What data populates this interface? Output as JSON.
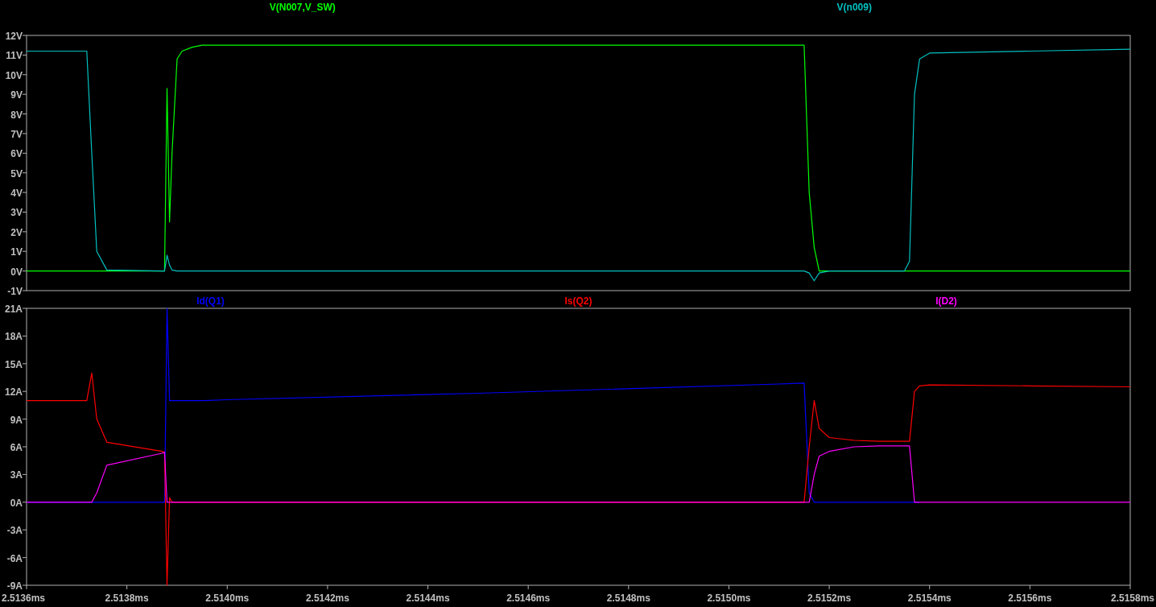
{
  "panes": [
    {
      "chart_data": {
        "type": "line",
        "x": [
          2.5136,
          2.51372,
          2.51373,
          2.51374,
          2.51376,
          2.51387,
          2.513875,
          2.51388,
          2.513885,
          2.51389,
          2.5139,
          2.51391,
          2.51393,
          2.51395,
          2.514,
          2.5145,
          2.5151,
          2.51515,
          2.51516,
          2.51517,
          2.51518,
          2.5152,
          2.51525,
          2.5153,
          2.51535,
          2.51536,
          2.51537,
          2.51538,
          2.5154,
          2.5156,
          2.5158
        ],
        "series": [
          {
            "name": "V(N007,V_SW)",
            "color": "#00ff00",
            "values": [
              0,
              0,
              0,
              0,
              0,
              0,
              0,
              9.3,
              2.5,
              6,
              10.8,
              11.2,
              11.4,
              11.5,
              11.5,
              11.5,
              11.5,
              11.5,
              4,
              1.2,
              0,
              0,
              0,
              0,
              0,
              0,
              0,
              0,
              0,
              0,
              0
            ]
          },
          {
            "name": "V(n009)",
            "color": "#00c0c0",
            "values": [
              11.2,
              11.2,
              6,
              1,
              0.05,
              0,
              0,
              0.8,
              0.3,
              0.05,
              0,
              0,
              0,
              0,
              0,
              0,
              0,
              0,
              -0.1,
              -0.5,
              -0.1,
              0,
              0,
              0,
              0,
              0.5,
              9,
              10.8,
              11.1,
              11.2,
              11.3
            ]
          }
        ],
        "xlim": [
          2.5136,
          2.5158
        ],
        "ylim": [
          -1,
          12
        ],
        "yticks": [
          {
            "value": 12,
            "label": "12V"
          },
          {
            "value": 11,
            "label": "11V"
          },
          {
            "value": 10,
            "label": "10V"
          },
          {
            "value": 9,
            "label": "9V"
          },
          {
            "value": 8,
            "label": "8V"
          },
          {
            "value": 7,
            "label": "7V"
          },
          {
            "value": 6,
            "label": "6V"
          },
          {
            "value": 5,
            "label": "5V"
          },
          {
            "value": 4,
            "label": "4V"
          },
          {
            "value": 3,
            "label": "3V"
          },
          {
            "value": 2,
            "label": "2V"
          },
          {
            "value": 1,
            "label": "1V"
          },
          {
            "value": 0,
            "label": "0V"
          },
          {
            "value": -1,
            "label": "-1V"
          }
        ]
      }
    },
    {
      "chart_data": {
        "type": "line",
        "x": [
          2.5136,
          2.51372,
          2.51373,
          2.51374,
          2.51376,
          2.51387,
          2.513875,
          2.51388,
          2.513885,
          2.51389,
          2.5139,
          2.51391,
          2.51393,
          2.51395,
          2.514,
          2.5145,
          2.5151,
          2.51515,
          2.51516,
          2.51517,
          2.51518,
          2.5152,
          2.51525,
          2.5153,
          2.51535,
          2.51536,
          2.51537,
          2.51538,
          2.5154,
          2.5156,
          2.5158
        ],
        "series": [
          {
            "name": "Id(Q1)",
            "color": "#0000ff",
            "values": [
              0,
              0,
              0,
              0,
              0,
              0,
              0,
              21,
              11,
              11,
              11,
              11,
              11,
              11,
              11.1,
              11.8,
              12.8,
              12.9,
              1,
              0,
              0,
              0,
              0,
              0,
              0,
              0,
              0,
              0,
              null,
              null,
              null
            ]
          },
          {
            "name": "Is(Q2)",
            "color": "#ff0000",
            "values": [
              11,
              11,
              14,
              9,
              6.5,
              5.5,
              5.4,
              -9,
              0.5,
              0,
              0,
              0,
              0,
              0,
              0,
              0,
              0,
              0,
              6,
              11,
              8,
              7,
              6.7,
              6.6,
              6.6,
              6.6,
              12,
              12.6,
              12.7,
              12.6,
              12.5
            ]
          },
          {
            "name": "I(D2)",
            "color": "#ff00ff",
            "values": [
              0,
              0,
              0,
              1,
              4,
              5.3,
              5.4,
              0,
              0,
              0,
              0,
              0,
              0,
              0,
              0,
              0,
              0,
              0,
              0,
              3,
              5,
              5.5,
              6,
              6.1,
              6.1,
              6.1,
              0,
              0,
              0,
              0,
              0
            ]
          }
        ],
        "xlim": [
          2.5136,
          2.5158
        ],
        "ylim": [
          -9,
          21
        ],
        "xticks": [
          {
            "value": 2.5136,
            "label": "2.5136ms"
          },
          {
            "value": 2.5138,
            "label": "2.5138ms"
          },
          {
            "value": 2.514,
            "label": "2.5140ms"
          },
          {
            "value": 2.5142,
            "label": "2.5142ms"
          },
          {
            "value": 2.5144,
            "label": "2.5144ms"
          },
          {
            "value": 2.5146,
            "label": "2.5146ms"
          },
          {
            "value": 2.5148,
            "label": "2.5148ms"
          },
          {
            "value": 2.515,
            "label": "2.5150ms"
          },
          {
            "value": 2.5152,
            "label": "2.5152ms"
          },
          {
            "value": 2.5154,
            "label": "2.5154ms"
          },
          {
            "value": 2.5156,
            "label": "2.5156ms"
          },
          {
            "value": 2.5158,
            "label": "2.5158ms"
          }
        ],
        "yticks": [
          {
            "value": 21,
            "label": "21A"
          },
          {
            "value": 18,
            "label": "18A"
          },
          {
            "value": 15,
            "label": "15A"
          },
          {
            "value": 12,
            "label": "12A"
          },
          {
            "value": 9,
            "label": "9A"
          },
          {
            "value": 6,
            "label": "6A"
          },
          {
            "value": 3,
            "label": "3A"
          },
          {
            "value": 0,
            "label": "0A"
          },
          {
            "value": -3,
            "label": "-3A"
          },
          {
            "value": -6,
            "label": "-6A"
          },
          {
            "value": -9,
            "label": "-9A"
          }
        ]
      }
    }
  ]
}
